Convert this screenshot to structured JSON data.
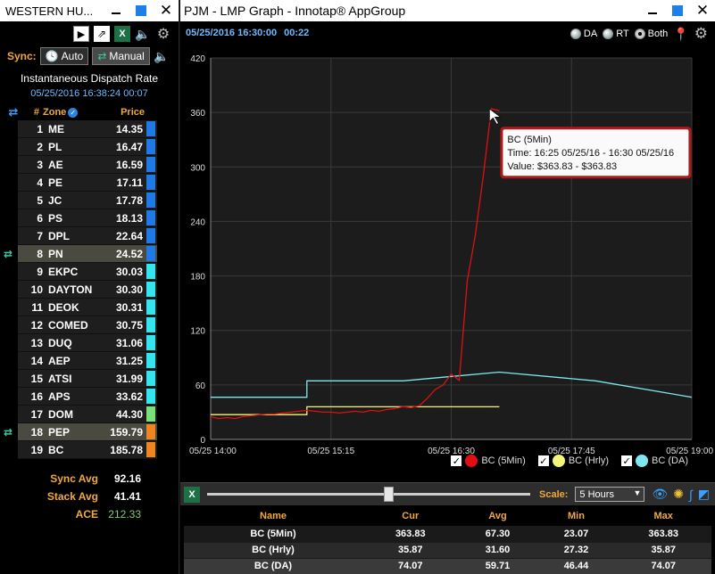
{
  "left": {
    "title": "WESTERN HU...",
    "sync_label": "Sync:",
    "auto_label": "Auto",
    "manual_label": "Manual",
    "panel_title": "Instantaneous Dispatch Rate",
    "panel_time": "05/25/2016 16:38:24  00:07",
    "headers": {
      "num": "#",
      "zone": "Zone",
      "price": "Price"
    },
    "zones": [
      {
        "num": "1",
        "zone": "ME",
        "price": "14.35",
        "color": "#1f7ae8"
      },
      {
        "num": "2",
        "zone": "PL",
        "price": "16.47",
        "color": "#1f7ae8"
      },
      {
        "num": "3",
        "zone": "AE",
        "price": "16.59",
        "color": "#1f7ae8"
      },
      {
        "num": "4",
        "zone": "PE",
        "price": "17.11",
        "color": "#1f7ae8"
      },
      {
        "num": "5",
        "zone": "JC",
        "price": "17.78",
        "color": "#1f7ae8"
      },
      {
        "num": "6",
        "zone": "PS",
        "price": "18.13",
        "color": "#1f7ae8"
      },
      {
        "num": "7",
        "zone": "DPL",
        "price": "22.64",
        "color": "#1f7ae8"
      },
      {
        "num": "8",
        "zone": "PN",
        "price": "24.52",
        "color": "#1f7ae8",
        "highlight": true
      },
      {
        "num": "9",
        "zone": "EKPC",
        "price": "30.03",
        "color": "#33e6ee"
      },
      {
        "num": "10",
        "zone": "DAYTON",
        "price": "30.30",
        "color": "#33e6ee"
      },
      {
        "num": "11",
        "zone": "DEOK",
        "price": "30.31",
        "color": "#33e6ee"
      },
      {
        "num": "12",
        "zone": "COMED",
        "price": "30.75",
        "color": "#33e6ee"
      },
      {
        "num": "13",
        "zone": "DUQ",
        "price": "31.06",
        "color": "#33e6ee"
      },
      {
        "num": "14",
        "zone": "AEP",
        "price": "31.25",
        "color": "#33e6ee"
      },
      {
        "num": "15",
        "zone": "ATSI",
        "price": "31.99",
        "color": "#33e6ee"
      },
      {
        "num": "16",
        "zone": "APS",
        "price": "33.62",
        "color": "#33e6ee"
      },
      {
        "num": "17",
        "zone": "DOM",
        "price": "44.30",
        "color": "#7ae07a"
      },
      {
        "num": "18",
        "zone": "PEP",
        "price": "159.79",
        "color": "#f0841e",
        "highlight": true
      },
      {
        "num": "19",
        "zone": "BC",
        "price": "185.78",
        "color": "#f0841e"
      }
    ],
    "summary": [
      {
        "label": "Sync Avg",
        "value": "92.16"
      },
      {
        "label": "Stack Avg",
        "value": "41.41"
      },
      {
        "label": "ACE",
        "value": "212.33"
      }
    ]
  },
  "right": {
    "title": "PJM - LMP Graph - Innotap® AppGroup",
    "date": "05/25/2016 16:30:00",
    "time": "00:22",
    "radio_da": "DA",
    "radio_rt": "RT",
    "radio_both": "Both",
    "legend": [
      {
        "label": "BC (5Min)",
        "color": "#e01010"
      },
      {
        "label": "BC (Hrly)",
        "color": "#f5f57a"
      },
      {
        "label": "BC (DA)",
        "color": "#7ee8ee"
      }
    ],
    "scale_label": "Scale:",
    "scale_value": "5 Hours",
    "slider_pos": 0.56,
    "tooltip": {
      "series": "BC (5Min)",
      "time": "Time: 16:25 05/25/16 - 16:30 05/25/16",
      "value": "Value: $363.83 - $363.83"
    },
    "stats": {
      "headers": [
        "Name",
        "Cur",
        "Avg",
        "Min",
        "Max"
      ],
      "rows": [
        [
          "BC (5Min)",
          "363.83",
          "67.30",
          "23.07",
          "363.83"
        ],
        [
          "BC (Hrly)",
          "35.87",
          "31.60",
          "27.32",
          "35.87"
        ],
        [
          "BC (DA)",
          "74.07",
          "59.71",
          "46.44",
          "74.07"
        ]
      ]
    }
  },
  "chart_data": {
    "type": "line",
    "x_tick_labels": [
      "05/25 14:00",
      "05/25 15:15",
      "05/25 16:30",
      "05/25 17:45",
      "05/25 19:00"
    ],
    "x_range_minutes": [
      0,
      300
    ],
    "ylim": [
      0,
      420
    ],
    "y_ticks": [
      0,
      60,
      120,
      180,
      240,
      300,
      360,
      420
    ],
    "grid": true,
    "series": [
      {
        "name": "BC (5Min)",
        "color": "#e01010",
        "x": [
          0,
          5,
          10,
          15,
          20,
          25,
          30,
          35,
          40,
          45,
          50,
          55,
          60,
          65,
          70,
          75,
          80,
          85,
          90,
          95,
          100,
          105,
          110,
          115,
          120,
          125,
          130,
          135,
          140,
          145,
          150,
          155,
          160,
          165,
          170,
          175,
          180
        ],
        "y": [
          25,
          23,
          24,
          23,
          25,
          26,
          27,
          28,
          28,
          29,
          30,
          31,
          32,
          31,
          30,
          30,
          29,
          30,
          31,
          30,
          32,
          31,
          33,
          34,
          36,
          35,
          37,
          45,
          55,
          60,
          72,
          65,
          175,
          225,
          290,
          364,
          362
        ]
      },
      {
        "name": "BC (Hrly)",
        "color": "#f5f57a",
        "x": [
          0,
          60,
          60,
          120,
          120,
          180
        ],
        "y": [
          27.32,
          27.32,
          35.87,
          35.87,
          35.87,
          35.87
        ]
      },
      {
        "name": "BC (DA)",
        "color": "#7ee8ee",
        "x": [
          0,
          60,
          60,
          120,
          120,
          180,
          180,
          240,
          240,
          300
        ],
        "y": [
          46.44,
          46.44,
          64.5,
          64.5,
          64.5,
          74.07,
          74.07,
          64.5,
          64.5,
          46.44
        ]
      }
    ],
    "tooltip_point": {
      "x": 175,
      "y": 363.83
    }
  }
}
